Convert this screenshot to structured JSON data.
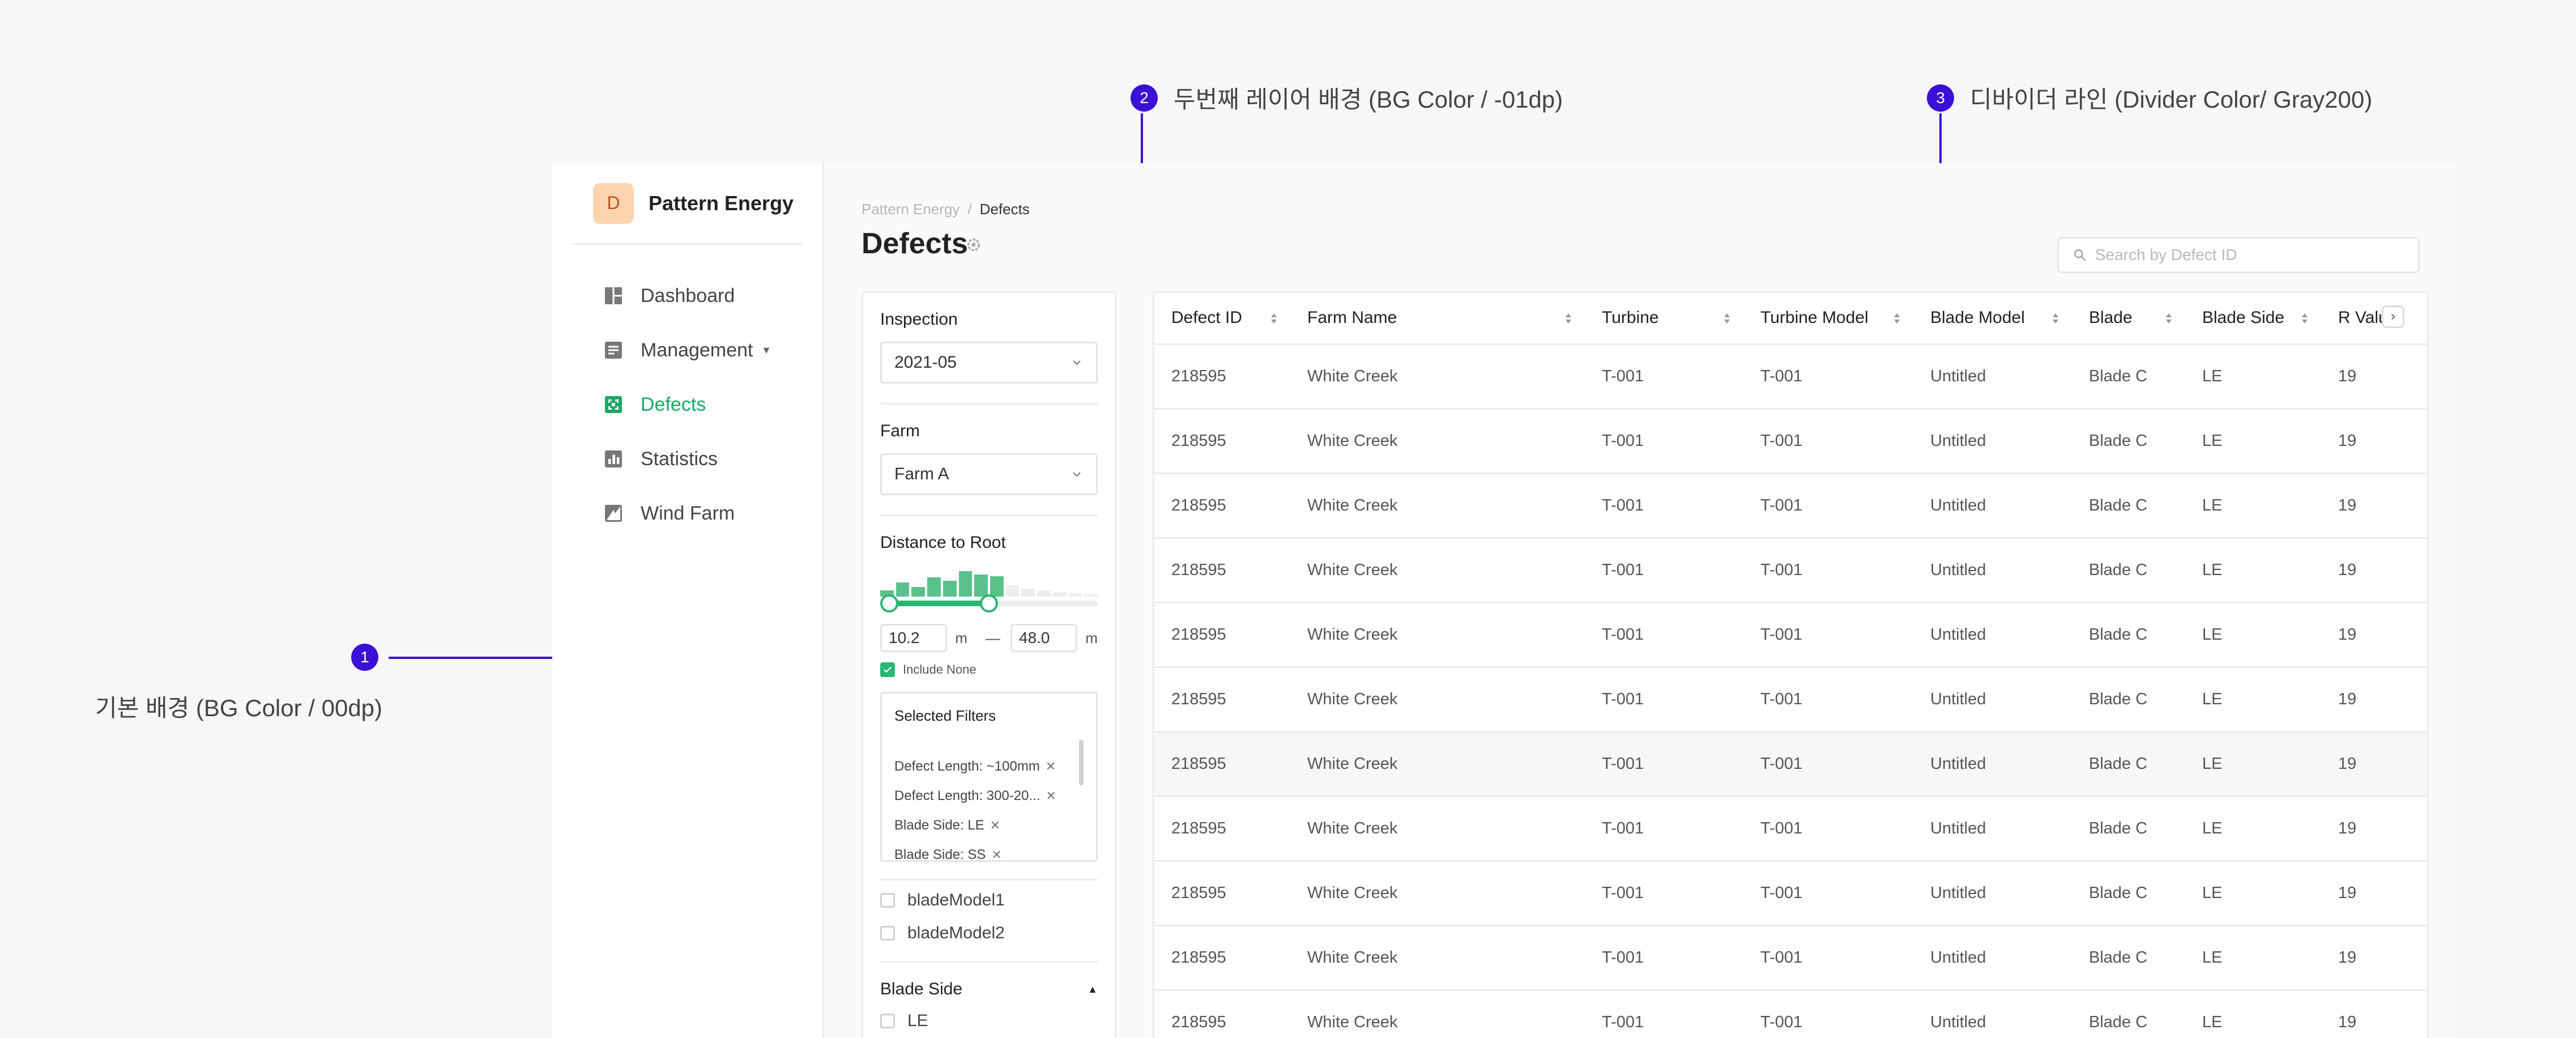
{
  "annotations": [
    {
      "number": "1",
      "label": "기본 배경 (BG Color / 00dp)"
    },
    {
      "number": "2",
      "label": "두번째 레이어 배경 (BG Color / -01dp)"
    },
    {
      "number": "3",
      "label": "디바이더 라인 (Divider Color/ Gray200)"
    }
  ],
  "brand": {
    "logo_letter": "D",
    "name": "Pattern Energy"
  },
  "sidebar": {
    "items": [
      {
        "label": "Dashboard",
        "icon": "dashboard-icon"
      },
      {
        "label": "Management",
        "icon": "management-icon",
        "has_caret": true
      },
      {
        "label": "Defects",
        "icon": "defects-icon",
        "active": true
      },
      {
        "label": "Statistics",
        "icon": "statistics-icon"
      },
      {
        "label": "Wind Farm",
        "icon": "wind-farm-icon"
      }
    ]
  },
  "breadcrumb": {
    "root": "Pattern Energy",
    "separator": "/",
    "current": "Defects"
  },
  "page": {
    "title": "Defects"
  },
  "search": {
    "placeholder": "Search by Defect ID"
  },
  "filters": {
    "inspection": {
      "label": "Inspection",
      "value": "2021-05"
    },
    "farm": {
      "label": "Farm",
      "value": "Farm A"
    },
    "distance": {
      "label": "Distance to Root",
      "min": "10.2",
      "max": "48.0",
      "unit": "m",
      "dash": "—",
      "include_none_label": "Include None",
      "include_none_checked": true
    },
    "selected": {
      "title": "Selected Filters",
      "chips": [
        "Defect Length: ~100mm",
        "Defect Length: 300-20...",
        "Blade Side: LE",
        "Blade Side: SS"
      ]
    },
    "blade_models": [
      "bladeModel1",
      "bladeModel2"
    ],
    "blade_side": {
      "label": "Blade Side",
      "options": [
        "LE"
      ]
    }
  },
  "table": {
    "columns": [
      "Defect ID",
      "Farm Name",
      "Turbine",
      "Turbine Model",
      "Blade Model",
      "Blade",
      "Blade Side",
      "R Value"
    ],
    "rows": [
      [
        "218595",
        "White Creek",
        "T-001",
        "T-001",
        "Untitled",
        "Blade C",
        "LE",
        "19"
      ],
      [
        "218595",
        "White Creek",
        "T-001",
        "T-001",
        "Untitled",
        "Blade C",
        "LE",
        "19"
      ],
      [
        "218595",
        "White Creek",
        "T-001",
        "T-001",
        "Untitled",
        "Blade C",
        "LE",
        "19"
      ],
      [
        "218595",
        "White Creek",
        "T-001",
        "T-001",
        "Untitled",
        "Blade C",
        "LE",
        "19"
      ],
      [
        "218595",
        "White Creek",
        "T-001",
        "T-001",
        "Untitled",
        "Blade C",
        "LE",
        "19"
      ],
      [
        "218595",
        "White Creek",
        "T-001",
        "T-001",
        "Untitled",
        "Blade C",
        "LE",
        "19"
      ],
      [
        "218595",
        "White Creek",
        "T-001",
        "T-001",
        "Untitled",
        "Blade C",
        "LE",
        "19"
      ],
      [
        "218595",
        "White Creek",
        "T-001",
        "T-001",
        "Untitled",
        "Blade C",
        "LE",
        "19"
      ],
      [
        "218595",
        "White Creek",
        "T-001",
        "T-001",
        "Untitled",
        "Blade C",
        "LE",
        "19"
      ],
      [
        "218595",
        "White Creek",
        "T-001",
        "T-001",
        "Untitled",
        "Blade C",
        "LE",
        "19"
      ],
      [
        "218595",
        "White Creek",
        "T-001",
        "T-001",
        "Untitled",
        "Blade C",
        "LE",
        "19"
      ]
    ],
    "highlighted_row": 6
  },
  "colors": {
    "accent": "#2ab673",
    "annotation": "#3b0fd6",
    "divider": "#ececec",
    "bg_00dp": "#ffffff",
    "bg_minus01dp": "#fafafa"
  }
}
